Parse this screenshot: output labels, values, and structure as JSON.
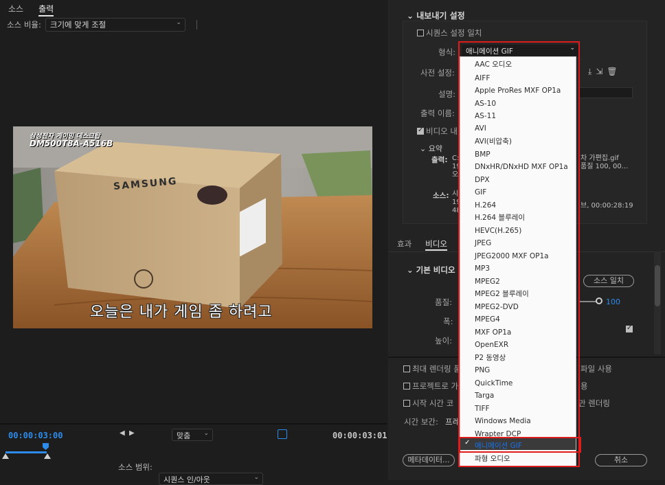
{
  "left_panel": {
    "tabs": [
      "소스",
      "출력"
    ],
    "source_scale_label": "소스 비율:",
    "source_scale_value": "크기에 맞게 조절",
    "video": {
      "overlay_title_line1": "삼성전자 게이밍 데스크탑",
      "overlay_title_line2": "DM500T8A-A516B",
      "box_brand": "SAMSUNG",
      "subtitle": "오늘은 내가 게임 좀 하려고"
    },
    "timecode_start": "00:00:03:00",
    "timecode_end": "00:00:03:01",
    "fit_label": "맞춤",
    "source_range_label": "소스 범위:",
    "source_range_value": "시퀀스 인/아웃"
  },
  "right_panel": {
    "export_settings_title": "내보내기 설정",
    "match_sequence_label": "시퀀스 설정 일치",
    "format_label": "형식:",
    "format_value": "애니메이션 GIF",
    "preset_label": "사전 설정:",
    "comment_label": "설명:",
    "output_name_label": "출력 이름:",
    "export_video_label": "비디오 내",
    "summary_title": "요약",
    "output_label": "출력:",
    "output_text_1": "C:",
    "output_text_right_1": "차 가편집.gif",
    "output_text_2": "19",
    "output_text_right_2": "품질 100, 00...",
    "output_text_3": "오",
    "source_label": "소스:",
    "source_text_1": "시",
    "source_text_2": "19",
    "source_text_3": "48",
    "source_text_right": "브, 00:00:28:19",
    "tabs": [
      "효과",
      "비디오"
    ],
    "basic_video_title": "기본 비디오",
    "match_source_button": "소스 일치",
    "quality_label": "품질:",
    "quality_value": "100",
    "width_label": "폭:",
    "height_label": "높이:",
    "max_render_label": "최대 렌더링 품",
    "use_proxy_label": "파일 사용",
    "import_project_label": "프로젝트로 가",
    "import_project_right": "용",
    "start_timecode_label": "시작 시간 코",
    "render_alpha_right": "만 렌더링",
    "time_interpolation_label": "시간 보간:",
    "time_interpolation_value": "프레",
    "metadata_button": "메타데이터...",
    "cancel_button": "취소"
  },
  "format_dropdown": {
    "options": [
      "AAC 오디오",
      "AIFF",
      "Apple ProRes MXF OP1a",
      "AS-10",
      "AS-11",
      "AVI",
      "AVI(비압축)",
      "BMP",
      "DNxHR/DNxHD MXF OP1a",
      "DPX",
      "GIF",
      "H.264",
      "H.264 블루레이",
      "HEVC(H.265)",
      "JPEG",
      "JPEG2000 MXF OP1a",
      "MP3",
      "MPEG2",
      "MPEG2 블루레이",
      "MPEG2-DVD",
      "MPEG4",
      "MXF OP1a",
      "OpenEXR",
      "P2 동영상",
      "PNG",
      "QuickTime",
      "Targa",
      "TIFF",
      "Windows Media",
      "Wrapter DCP",
      "애니메이션 GIF",
      "파형 오디오"
    ],
    "selected_index": 30
  },
  "colors": {
    "accent": "#1a73e8",
    "highlight": "#e01b1b",
    "timecode": "#2d8ceb"
  }
}
